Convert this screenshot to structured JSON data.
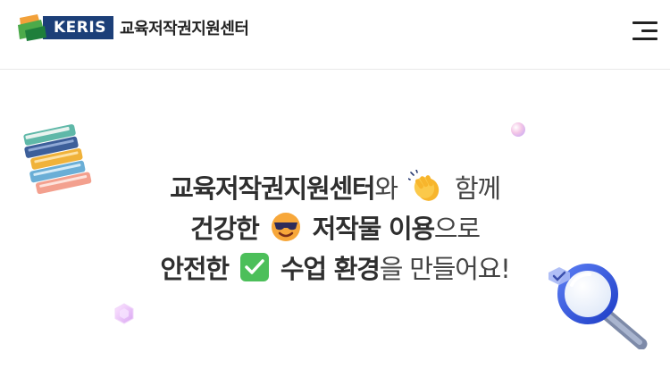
{
  "header": {
    "logo_text": "KERIS",
    "org_name": "교육저작권지원센터",
    "menu_icon": "hamburger-menu-icon"
  },
  "hero": {
    "line1": {
      "bold": "교육저작권지원센터",
      "normal1": "와",
      "emoji": "clapping-hands-icon",
      "normal2": "함께"
    },
    "line2": {
      "bold1": "건강한",
      "emoji": "sunglasses-face-icon",
      "bold2": "저작물 이용",
      "normal": "으로"
    },
    "line3": {
      "bold1": "안전한",
      "emoji": "check-mark-icon",
      "bold2": "수업 환경",
      "normal": "을 만들어요!"
    }
  },
  "colors": {
    "brand_navy": "#1c3f78",
    "text_dark": "#333333",
    "divider": "#e9e9e9"
  }
}
